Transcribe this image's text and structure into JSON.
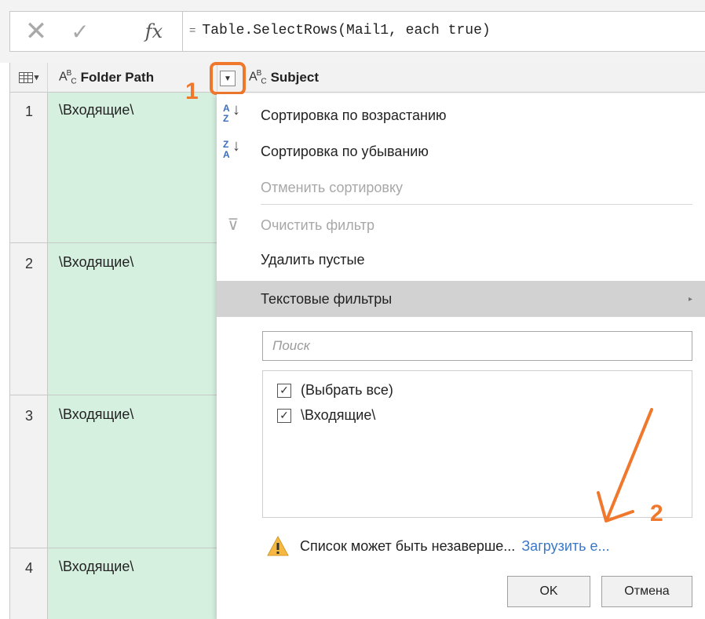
{
  "formula_bar": {
    "cancel_icon": "cancel-x-icon",
    "commit_icon": "check-icon",
    "fx_label": "fx",
    "equals": "=",
    "formula": "Table.SelectRows(Mail1, each true)"
  },
  "table": {
    "columns": [
      {
        "type_label": "ABC",
        "name": "Folder Path"
      },
      {
        "type_label": "ABC",
        "name": "Subject"
      }
    ],
    "rows": [
      {
        "num": "1",
        "folder_path": "\\Входящие\\"
      },
      {
        "num": "2",
        "folder_path": "\\Входящие\\"
      },
      {
        "num": "3",
        "folder_path": "\\Входящие\\"
      },
      {
        "num": "4",
        "folder_path": "\\Входящие\\"
      }
    ]
  },
  "callouts": {
    "one": "1",
    "two": "2",
    "accent": "#f0782d"
  },
  "filter_menu": {
    "sort_asc": "Сортировка по возрастанию",
    "sort_desc": "Сортировка по убыванию",
    "clear_sort": "Отменить сортировку",
    "clear_filter": "Очистить фильтр",
    "remove_empty": "Удалить пустые",
    "text_filters": "Текстовые фильтры",
    "search_placeholder": "Поиск",
    "items": [
      {
        "label": "(Выбрать все)",
        "checked": true
      },
      {
        "label": "\\Входящие\\",
        "checked": true
      }
    ],
    "warning_text": "Список может быть незаверше...",
    "load_more": "Загрузить е...",
    "ok": "OK",
    "cancel": "Отмена"
  }
}
